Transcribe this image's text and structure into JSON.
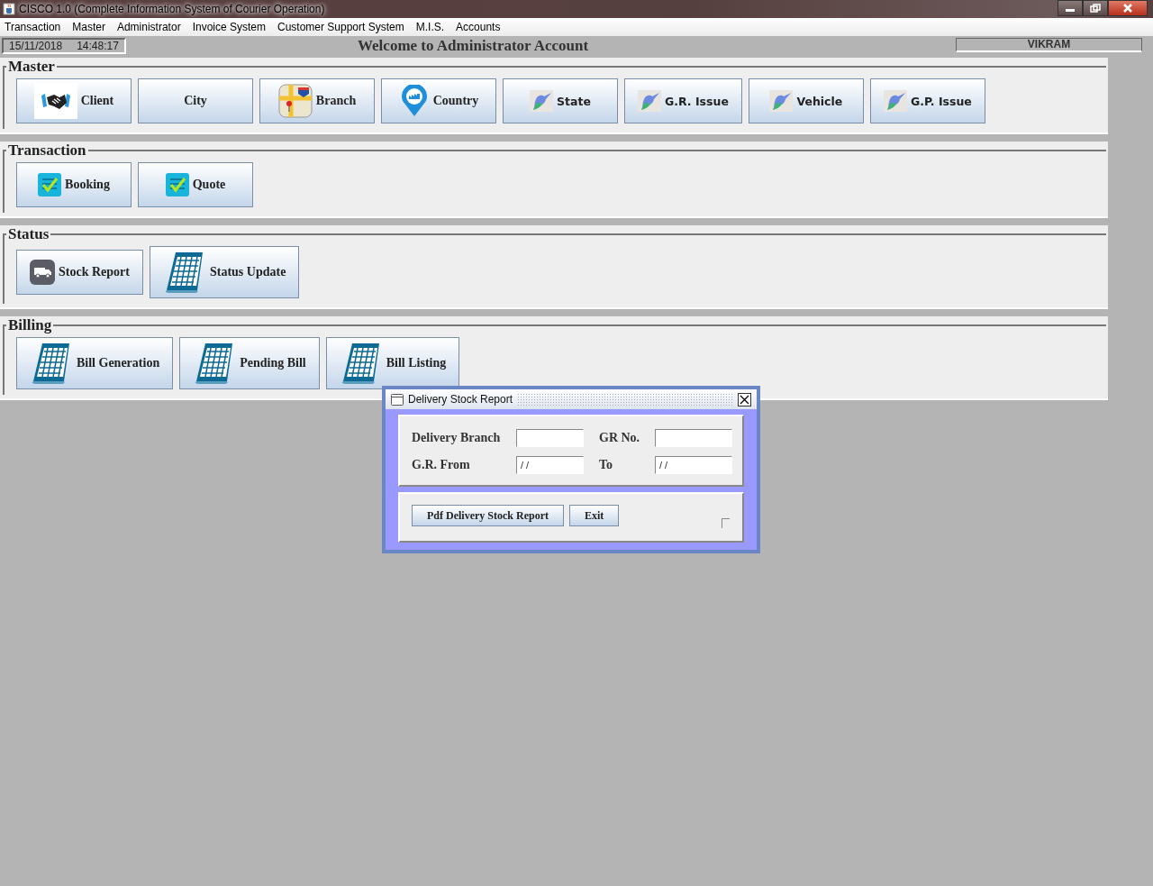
{
  "window": {
    "title": "CISCO 1.0 (Complete Information System of Courier Operation)"
  },
  "menu": [
    {
      "label": "Transaction"
    },
    {
      "label": "Master"
    },
    {
      "label": "Administrator"
    },
    {
      "label": "Invoice System"
    },
    {
      "label": "Customer Support System"
    },
    {
      "label": "M.I.S."
    },
    {
      "label": "Accounts"
    }
  ],
  "status": {
    "date": "15/11/2018",
    "time": "14:48:17",
    "welcome": "Welcome to Administrator Account",
    "user": "VIKRAM"
  },
  "sections": [
    {
      "title": "Master",
      "buttons": [
        {
          "label": "Client",
          "kind": "handshake"
        },
        {
          "label": "City",
          "kind": "plain"
        },
        {
          "label": "Branch",
          "kind": "map"
        },
        {
          "label": "Country",
          "kind": "pin"
        },
        {
          "label": "State",
          "kind": "bird"
        },
        {
          "label": "G.R. Issue",
          "kind": "bird"
        },
        {
          "label": "Vehicle",
          "kind": "bird"
        },
        {
          "label": "G.P. Issue",
          "kind": "bird"
        }
      ]
    },
    {
      "title": "Transaction",
      "buttons": [
        {
          "label": "Booking",
          "kind": "checklist"
        },
        {
          "label": "Quote",
          "kind": "checklist"
        }
      ]
    },
    {
      "title": "Status",
      "buttons": [
        {
          "label": "Stock Report",
          "kind": "truck"
        },
        {
          "label": "Status Update",
          "kind": "calendar"
        }
      ]
    },
    {
      "title": "Billing",
      "buttons": [
        {
          "label": "Bill Generation",
          "kind": "calendar"
        },
        {
          "label": "Pending Bill",
          "kind": "calendar"
        },
        {
          "label": "Bill Listing",
          "kind": "calendar"
        }
      ]
    }
  ],
  "dialog": {
    "title": "Delivery Stock Report",
    "fields": [
      {
        "label": "Delivery Branch"
      },
      {
        "label": "GR No."
      },
      {
        "label": "G.R. From",
        "value": "/ /"
      },
      {
        "label": "To",
        "value": "/ /"
      }
    ],
    "buttons": [
      {
        "label": "Pdf Delivery Stock Report"
      },
      {
        "label": "Exit"
      }
    ]
  }
}
